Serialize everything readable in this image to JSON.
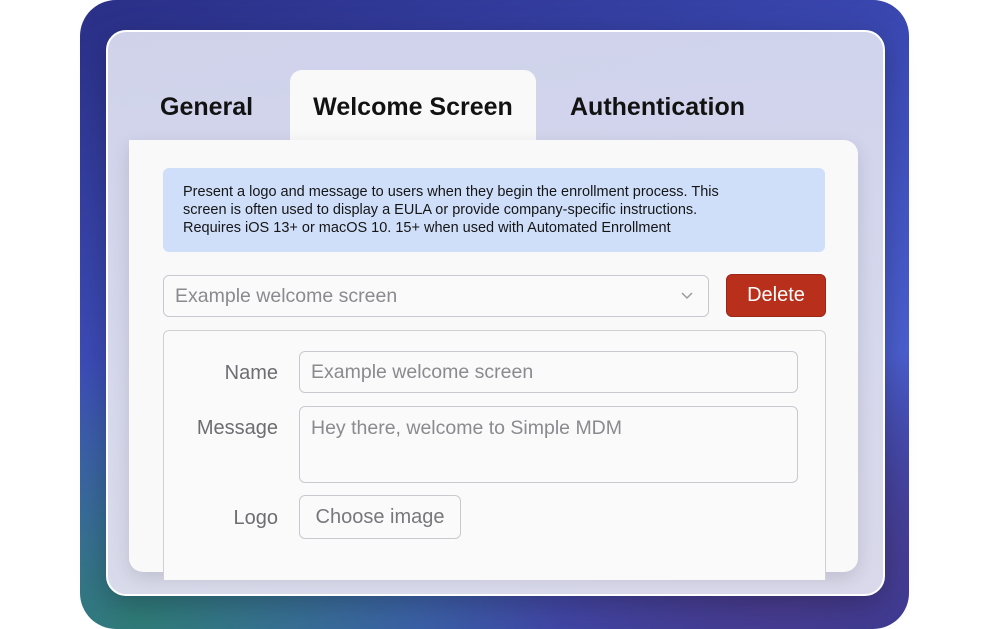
{
  "tabs": [
    {
      "label": "General"
    },
    {
      "label": "Welcome Screen",
      "active": true
    },
    {
      "label": "Authentication"
    }
  ],
  "info": {
    "line1": "Present a logo and message to users when they begin the enrollment process. This",
    "line2": "screen is often used to display a EULA or provide company-specific instructions.",
    "line3": "Requires iOS 13+ or macOS 10. 15+ when used with Automated Enrollment"
  },
  "selector": {
    "value": "Example welcome screen"
  },
  "delete_label": "Delete",
  "form": {
    "name_label": "Name",
    "name_placeholder": "Example welcome screen",
    "message_label": "Message",
    "message_placeholder": "Hey there, welcome to Simple MDM",
    "logo_label": "Logo",
    "logo_button": "Choose image"
  },
  "colors": {
    "delete": "#b8301c",
    "info_bg": "#cfdffa"
  }
}
